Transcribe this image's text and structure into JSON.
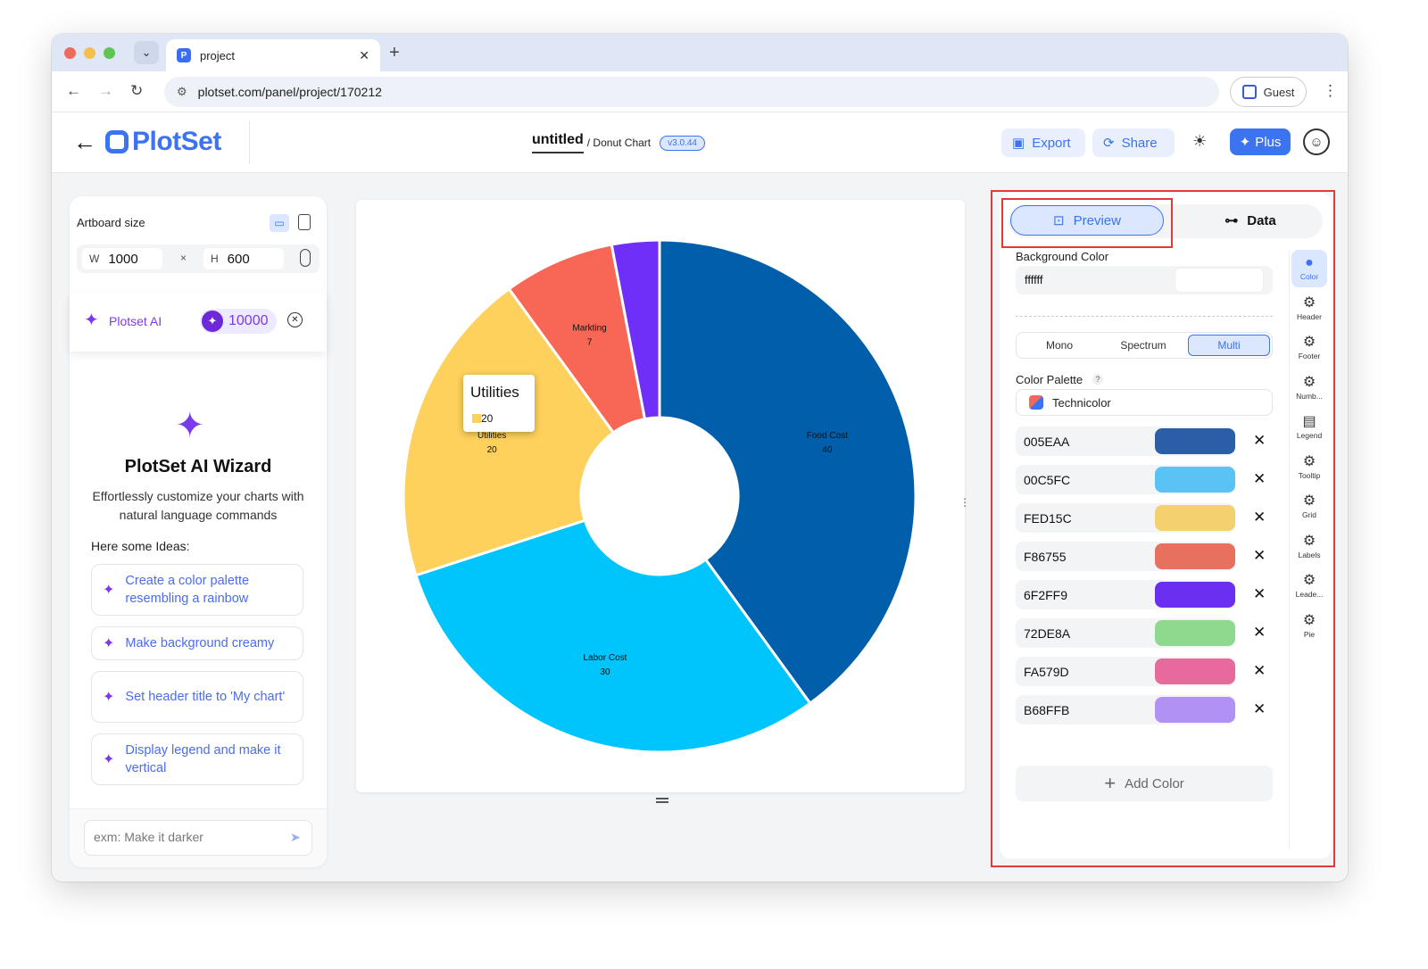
{
  "browser": {
    "tab_title": "project",
    "url": "plotset.com/panel/project/170212",
    "guest_label": "Guest"
  },
  "header": {
    "logo_text": "PlotSet",
    "doc_title": "untitled",
    "doc_type": "/ Donut Chart",
    "version": "v3.0.44",
    "export_label": "Export",
    "share_label": "Share",
    "plus_label": "Plus"
  },
  "left_panel": {
    "artboard_label": "Artboard size",
    "w_label": "W",
    "w_value": "1000",
    "h_label": "H",
    "h_value": "600",
    "times": "×",
    "ai_name": "Plotset AI",
    "credits": "10000",
    "wizard_title": "PlotSet AI Wizard",
    "wizard_desc": "Effortlessly customize your charts with natural language commands",
    "ideas_label": "Here some Ideas:",
    "ideas": [
      "Create a color palette resembling a rainbow",
      "Make background creamy",
      "Set header title to 'My chart'",
      "Display legend and make it vertical"
    ],
    "prompt_placeholder": "exm: Make it darker"
  },
  "chart_data": {
    "type": "pie",
    "variant": "donut",
    "categories": [
      "Food Cost",
      "Labor Cost",
      "Utilities",
      "Markting",
      ""
    ],
    "values": [
      40,
      30,
      20,
      7,
      3
    ],
    "colors": [
      "#005EAA",
      "#00C5FC",
      "#FED15C",
      "#F86755",
      "#6F2FF9"
    ],
    "label_values": [
      "40",
      "30",
      "20",
      "7",
      ""
    ],
    "tooltip": {
      "title": "Utilities",
      "value": "20",
      "color": "#FED15C"
    }
  },
  "right_panel": {
    "preview_tab": "Preview",
    "data_tab": "Data",
    "bg_label": "Background Color",
    "bg_value": "ffffff",
    "modes": [
      "Mono",
      "Spectrum",
      "Multi"
    ],
    "palette_label": "Color Palette",
    "palette_help": "?",
    "palette_name": "Technicolor",
    "colors": [
      {
        "hex": "005EAA",
        "color": "#2A5EA6"
      },
      {
        "hex": "00C5FC",
        "color": "#5BC2F6"
      },
      {
        "hex": "FED15C",
        "color": "#F5D06E"
      },
      {
        "hex": "F86755",
        "color": "#E8705E"
      },
      {
        "hex": "6F2FF9",
        "color": "#6A2FF0"
      },
      {
        "hex": "72DE8A",
        "color": "#8FD98F"
      },
      {
        "hex": "FA579D",
        "color": "#E66A9C"
      },
      {
        "hex": "B68FFB",
        "color": "#B291F5"
      }
    ],
    "add_color": "Add Color",
    "sidebar": [
      "Color",
      "Header",
      "Footer",
      "Numb...",
      "Legend",
      "Tooltip",
      "Grid",
      "Labels",
      "Leade...",
      "Pie"
    ]
  }
}
